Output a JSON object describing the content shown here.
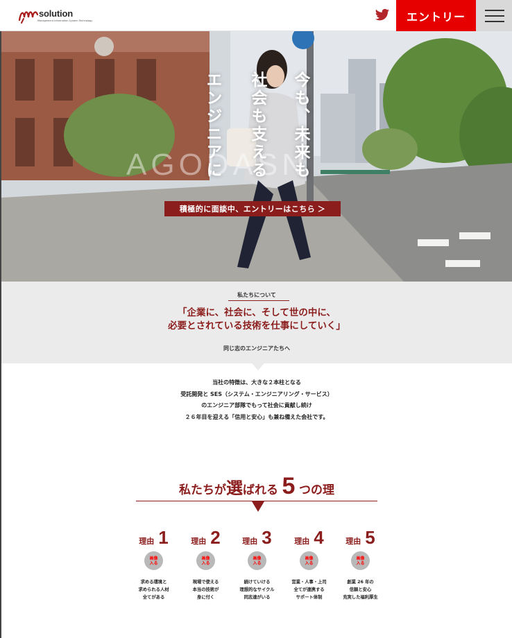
{
  "header": {
    "logo_text": "solution",
    "logo_subtext": "Management Information System Technology",
    "twitter_icon": "twitter-bird-icon",
    "entry_label": "エントリー",
    "menu_icon": "hamburger-menu-icon"
  },
  "hero": {
    "catch_lines": [
      "今も、未来も",
      "社会も支える",
      "エンジニアに"
    ],
    "watermark": "AGODASN",
    "cta_label": "積極的に面談中、エントリーはこちら ＞"
  },
  "about": {
    "label": "私たちについて",
    "headline_1": "「企業に、社会に、そして世の中に、",
    "headline_2": "必要とされている技術を仕事にしていく」",
    "sub": "同じ志のエンジニアたちへ"
  },
  "intro": {
    "lines": [
      "当社の特徴は、大きな２本柱となる",
      "受託開発と SES（システム・エンジニアリング・サービス）",
      "のエンジニア部隊でもって社会に貢献し続け",
      "２６年目を迎える「信用と安心」も兼ね備えた会社です。"
    ]
  },
  "reasons": {
    "title_a": "私たちが",
    "title_b": "選",
    "title_c": "ばれる",
    "title_num": "5",
    "title_d": "つの理",
    "items": [
      {
        "label": "理由",
        "num": "1",
        "img": "画像\n入る",
        "desc": "求める環境と\n求められる人材\n全てがある"
      },
      {
        "label": "理由",
        "num": "2",
        "img": "画像\n入る",
        "desc": "現場で使える\n本当の技術が\n身に付く"
      },
      {
        "label": "理由",
        "num": "3",
        "img": "画像\n入る",
        "desc": "続けていける\n理想的なサイクル\n同志達がいる"
      },
      {
        "label": "理由",
        "num": "4",
        "img": "画像\n入る",
        "desc": "営業・人事・上司\n全てが連携する\nサポート体制"
      },
      {
        "label": "理由",
        "num": "5",
        "img": "画像\n入る",
        "desc": "創業 26 年の\n信頼と安心\n充実した福利厚生"
      }
    ]
  },
  "colors": {
    "accent": "#8c1d1d",
    "entry": "#e60000",
    "band": "#ebebeb"
  }
}
